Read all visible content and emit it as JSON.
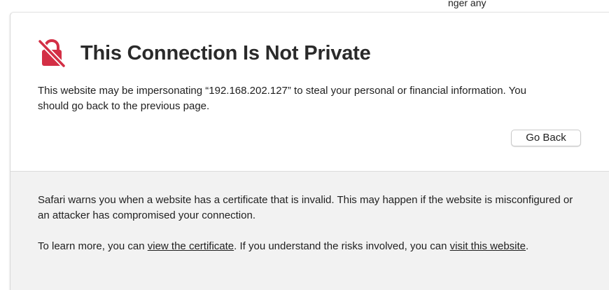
{
  "top_crop_text": "nger any",
  "warning": {
    "title": "This Connection Is Not Private",
    "message": "This website may be impersonating “192.168.202.127” to steal your personal or financial information. You should go back to the previous page.",
    "go_back_label": "Go Back",
    "icon": "lock-slash-icon"
  },
  "details": {
    "paragraph1": "Safari warns you when a website has a certificate that is invalid. This may happen if the website is misconfigured or an attacker has compromised your connection.",
    "paragraph2_prefix": "To learn more, you can ",
    "view_certificate_link": "view the certificate",
    "paragraph2_middle": ". If you understand the risks involved, you can ",
    "visit_website_link": "visit this website",
    "paragraph2_suffix": "."
  },
  "colors": {
    "icon_red": "#d32f45",
    "panel_bg": "#ffffff",
    "lower_bg": "#f2f2f2",
    "text": "#1f1f1f"
  }
}
